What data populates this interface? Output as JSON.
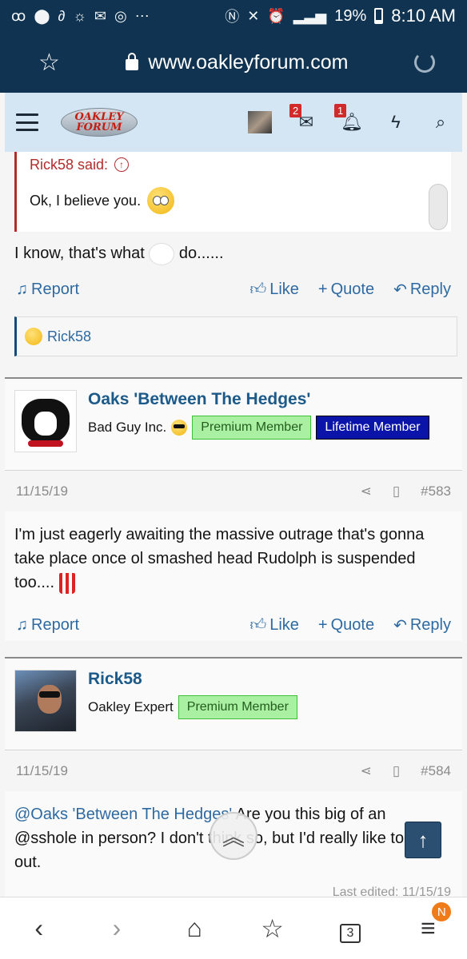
{
  "status_bar": {
    "battery": "19%",
    "time": "8:10 AM"
  },
  "browser": {
    "url": "www.oakleyforum.com",
    "tab_count": "3",
    "menu_badge": "N"
  },
  "site": {
    "logo_line1": "OAKLEY",
    "logo_line2": "FORUM",
    "conversations_count": "2",
    "alerts_count": "1"
  },
  "quoted": {
    "author_said": "Rick58 said:",
    "text": "Ok, I believe you."
  },
  "post_582": {
    "text_before": "I know, that's what",
    "text_after": "do......",
    "reaction_user": "Rick58"
  },
  "actions": {
    "report": "Report",
    "like": "Like",
    "quote": "Quote",
    "reply": "Reply"
  },
  "post_583": {
    "username": "Oaks 'Between The Hedges'",
    "user_title": "Bad Guy Inc.",
    "badges": [
      "Premium Member",
      "Lifetime Member"
    ],
    "date": "11/15/19",
    "number": "#583",
    "body": "I'm just eagerly awaiting the massive outrage that's gonna take place once ol smashed head Rudolph is suspended too...."
  },
  "post_584": {
    "username": "Rick58",
    "user_title": "Oakley Expert",
    "badge": "Premium Member",
    "date": "11/15/19",
    "number": "#584",
    "mention": "@Oaks 'Between The Hedges'",
    "body": " Are you this big of an @sshole in person? I don't think so, but I'd really like to find out.",
    "last_edited": "Last edited: 11/15/19"
  }
}
